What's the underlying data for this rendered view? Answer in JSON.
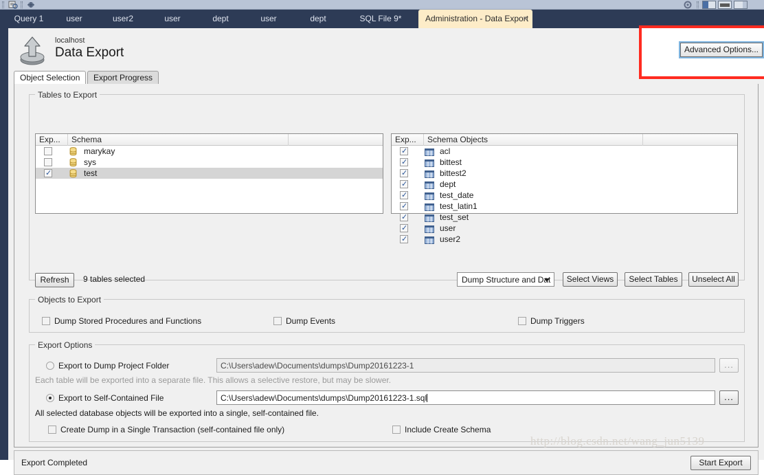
{
  "toolbar": {
    "icons": [
      "script-icon",
      "connect-icon"
    ],
    "panel_toggles": [
      "sidebar-toggle-icon",
      "output-toggle-icon",
      "secondary-toggle-icon"
    ],
    "gear_icon": "gear-icon"
  },
  "tabbar": {
    "tabs": [
      {
        "label": "Query 1",
        "active": false
      },
      {
        "label": "user",
        "active": false
      },
      {
        "label": "user2",
        "active": false
      },
      {
        "label": "user",
        "active": false
      },
      {
        "label": "dept",
        "active": false
      },
      {
        "label": "user",
        "active": false
      },
      {
        "label": "dept",
        "active": false
      },
      {
        "label": "SQL File 9*",
        "active": false
      },
      {
        "label": "Administration - Data Export",
        "active": true,
        "close": "×"
      }
    ]
  },
  "header": {
    "host": "localhost",
    "title": "Data Export",
    "icon": "export-upload-icon",
    "advanced_options_label": "Advanced Options...",
    "highlight_color": "#ff2b20"
  },
  "subtabs": [
    {
      "label": "Object Selection",
      "active": true
    },
    {
      "label": "Export Progress",
      "active": false
    }
  ],
  "tables_to_export": {
    "group_label": "Tables to Export",
    "schema_pane": {
      "columns": [
        "Exp...",
        "Schema"
      ],
      "rows": [
        {
          "checked": false,
          "name": "marykay",
          "selected": false,
          "icon": "schema-icon"
        },
        {
          "checked": false,
          "name": "sys",
          "selected": false,
          "icon": "schema-icon"
        },
        {
          "checked": true,
          "name": "test",
          "selected": true,
          "icon": "schema-icon"
        }
      ]
    },
    "objects_pane": {
      "columns": [
        "Exp...",
        "Schema Objects"
      ],
      "rows": [
        {
          "checked": true,
          "name": "acl",
          "icon": "table-icon"
        },
        {
          "checked": true,
          "name": "bittest",
          "icon": "table-icon"
        },
        {
          "checked": true,
          "name": "bittest2",
          "icon": "table-icon"
        },
        {
          "checked": true,
          "name": "dept",
          "icon": "table-icon"
        },
        {
          "checked": true,
          "name": "test_date",
          "icon": "table-icon"
        },
        {
          "checked": true,
          "name": "test_latin1",
          "icon": "table-icon"
        },
        {
          "checked": true,
          "name": "test_set",
          "icon": "table-icon"
        },
        {
          "checked": true,
          "name": "user",
          "icon": "table-icon"
        },
        {
          "checked": true,
          "name": "user2",
          "icon": "table-icon"
        }
      ]
    },
    "refresh_label": "Refresh",
    "selection_status": "9 tables selected",
    "dump_type": "Dump Structure and Dat",
    "select_views_label": "Select Views",
    "select_tables_label": "Select Tables",
    "unselect_all_label": "Unselect All"
  },
  "objects_to_export": {
    "group_label": "Objects to Export",
    "options": [
      {
        "label": "Dump Stored Procedures and Functions",
        "checked": false
      },
      {
        "label": "Dump Events",
        "checked": false
      },
      {
        "label": "Dump Triggers",
        "checked": false
      }
    ]
  },
  "export_options": {
    "group_label": "Export Options",
    "project_folder": {
      "label": "Export to Dump Project Folder",
      "selected": false,
      "path": "C:\\Users\\adew\\Documents\\dumps\\Dump20161223-1",
      "browse_label": "...",
      "hint": "Each table will be exported into a separate file. This allows a selective restore, but may be slower."
    },
    "self_contained": {
      "label": "Export to Self-Contained File",
      "selected": true,
      "path": "C:\\Users\\adew\\Documents\\dumps\\Dump20161223-1.sql",
      "browse_label": "...",
      "hint": "All selected database objects will be exported into a single, self-contained file."
    },
    "extra_options": [
      {
        "label": "Create Dump in a Single Transaction (self-contained file only)",
        "checked": false
      },
      {
        "label": "Include Create Schema",
        "checked": false
      }
    ]
  },
  "statusbar": {
    "status": "Export Completed",
    "start_export_label": "Start Export"
  },
  "watermark": "http://blog.csdn.net/wang_jun5139"
}
